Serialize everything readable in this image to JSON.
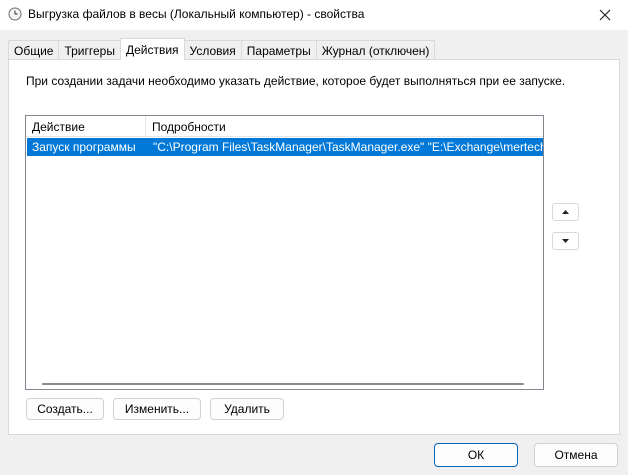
{
  "window": {
    "title": "Выгрузка файлов в весы (Локальный компьютер) - свойства"
  },
  "tabs": [
    {
      "label": "Общие"
    },
    {
      "label": "Триггеры"
    },
    {
      "label": "Действия"
    },
    {
      "label": "Условия"
    },
    {
      "label": "Параметры"
    },
    {
      "label": "Журнал (отключен)"
    }
  ],
  "active_tab": "Действия",
  "actions": {
    "description": "При создании задачи необходимо указать действие, которое будет выполняться при ее запуске.",
    "columns": [
      "Действие",
      "Подробности"
    ],
    "rows": [
      {
        "action": "Запуск программы",
        "details": "\"C:\\Program Files\\TaskManager\\TaskManager.exe\" \"E:\\Exchange\\mertech\\"
      }
    ],
    "create_label": "Создать...",
    "edit_label": "Изменить...",
    "delete_label": "Удалить"
  },
  "footer": {
    "ok_label": "ОК",
    "cancel_label": "Отмена"
  },
  "icons": {
    "app": "clock-icon",
    "close": "close-icon",
    "move_up": "arrow-up-icon",
    "move_down": "arrow-down-icon"
  },
  "colors": {
    "selection": "#0078d7",
    "accent_border": "#0067c0"
  }
}
